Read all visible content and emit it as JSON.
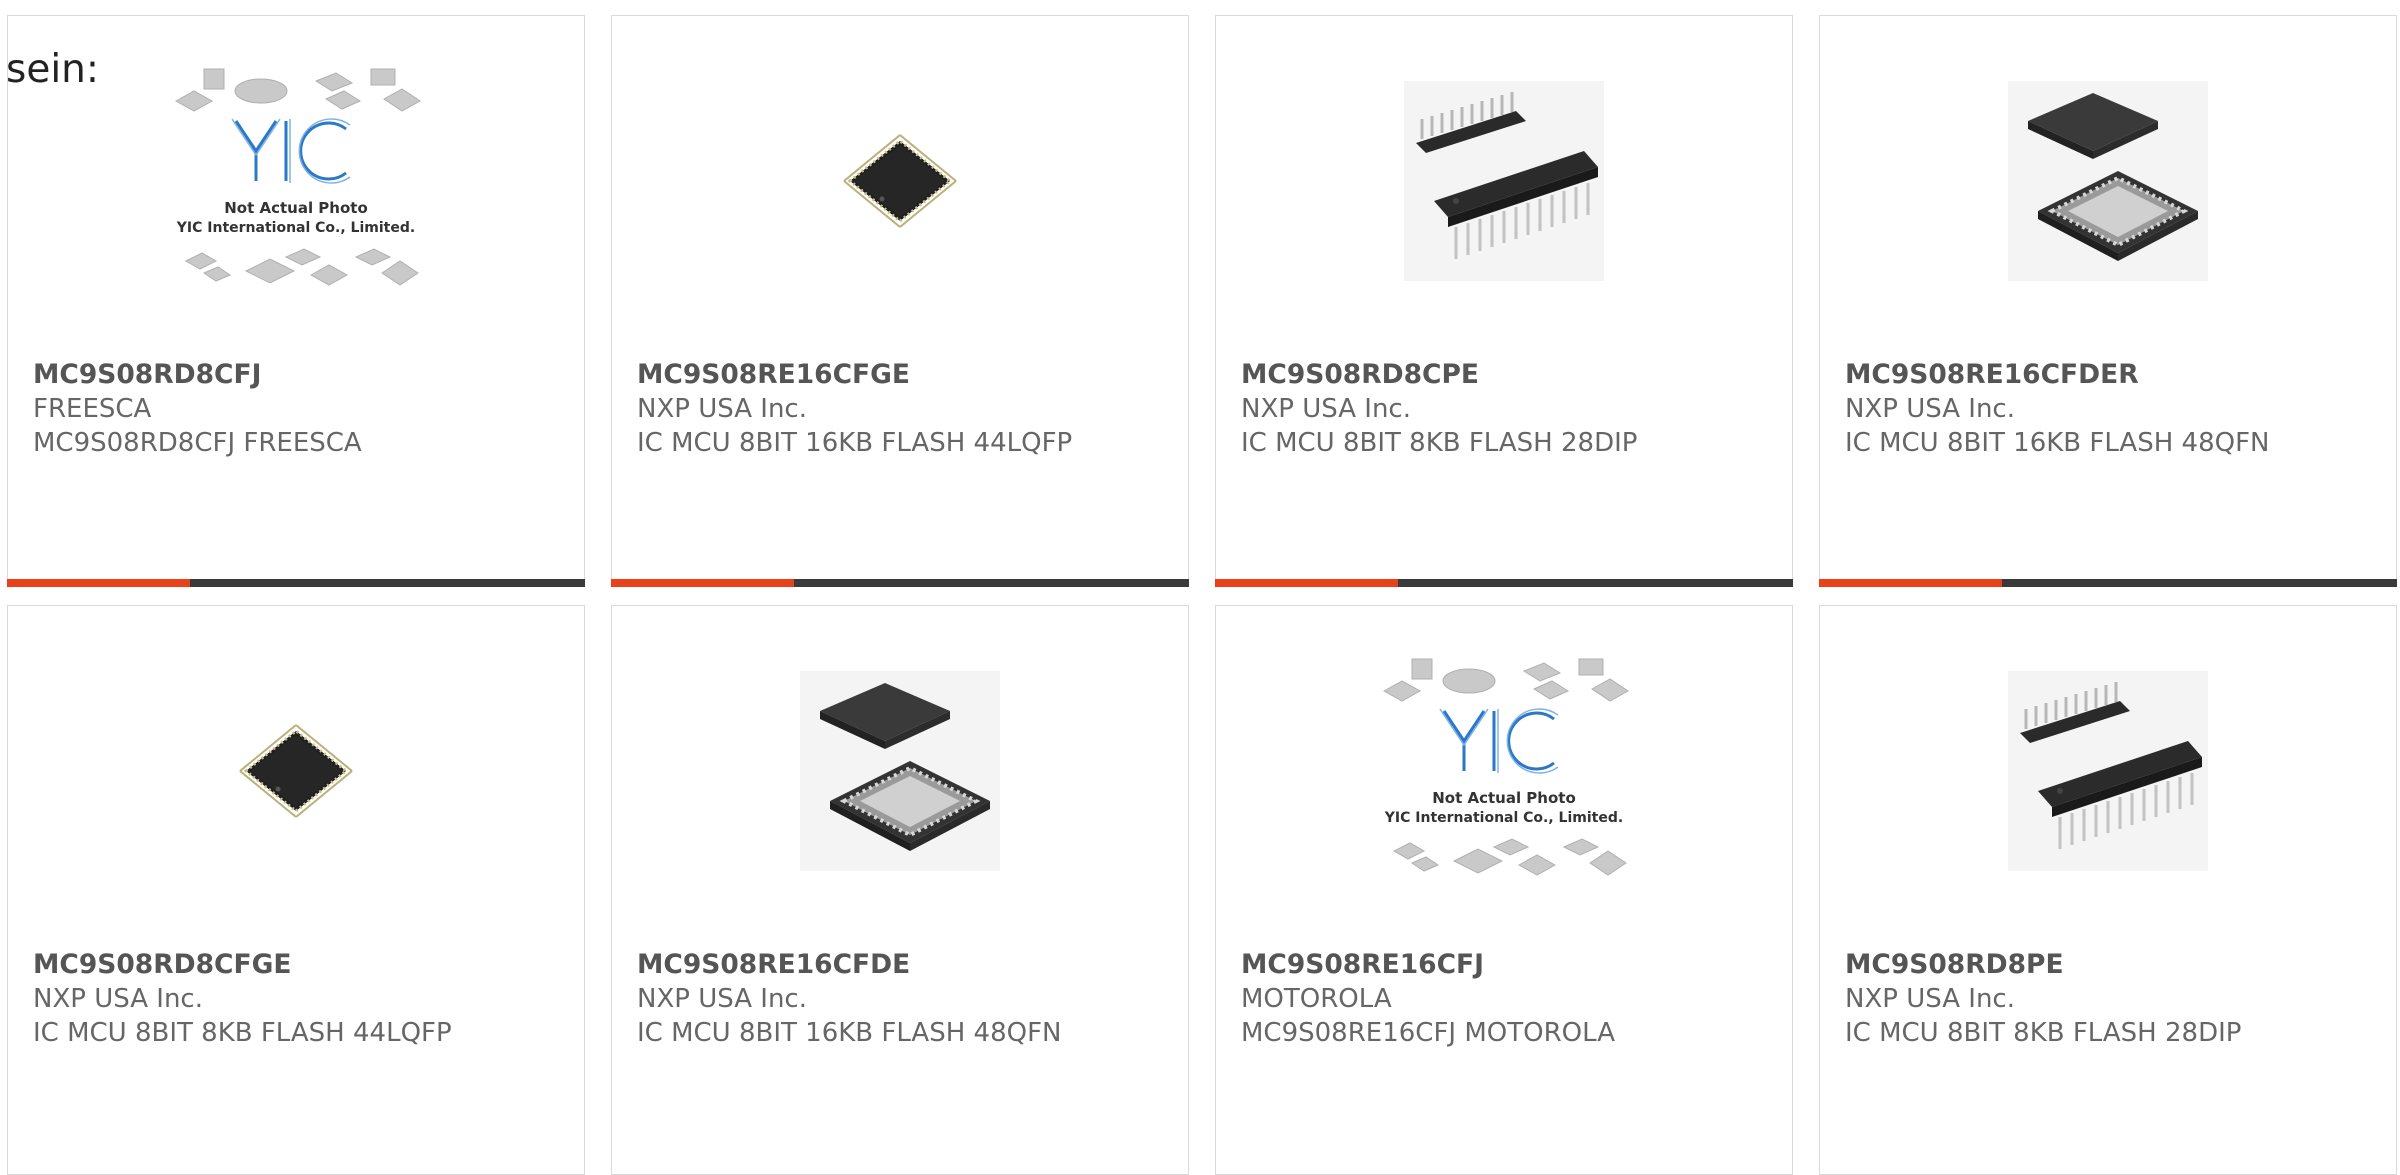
{
  "page": {
    "lead_text": "sein:"
  },
  "placeholder": {
    "line1": "Not Actual Photo",
    "line2": "YIC International Co., Limited.",
    "logo": "YIC"
  },
  "products": [
    {
      "part": "MC9S08RD8CFJ",
      "manufacturer": "FREESCA",
      "description": "MC9S08RD8CFJ FREESCA",
      "image": "placeholder-photo"
    },
    {
      "part": "MC9S08RE16CFGE",
      "manufacturer": "NXP USA Inc.",
      "description": "IC MCU 8BIT 16KB FLASH 44LQFP",
      "image": "lqfp-chip"
    },
    {
      "part": "MC9S08RD8CPE",
      "manufacturer": "NXP USA Inc.",
      "description": "IC MCU 8BIT 8KB FLASH 28DIP",
      "image": "dip-chip"
    },
    {
      "part": "MC9S08RE16CFDER",
      "manufacturer": "NXP USA Inc.",
      "description": "IC MCU 8BIT 16KB FLASH 48QFN",
      "image": "qfn-chip"
    },
    {
      "part": "MC9S08RD8CFGE",
      "manufacturer": "NXP USA Inc.",
      "description": "IC MCU 8BIT 8KB FLASH 44LQFP",
      "image": "lqfp-chip"
    },
    {
      "part": "MC9S08RE16CFDE",
      "manufacturer": "NXP USA Inc.",
      "description": "IC MCU 8BIT 16KB FLASH 48QFN",
      "image": "qfn-chip"
    },
    {
      "part": "MC9S08RE16CFJ",
      "manufacturer": "MOTOROLA",
      "description": "MC9S08RE16CFJ MOTOROLA",
      "image": "placeholder-photo"
    },
    {
      "part": "MC9S08RD8PE",
      "manufacturer": "NXP USA Inc.",
      "description": "IC MCU 8BIT 8KB FLASH 28DIP",
      "image": "dip-chip"
    }
  ],
  "colors": {
    "accent": "#e8411c",
    "bar": "#3a3a3a",
    "border": "#d9d9d9",
    "logo_blue": "#2a78c7"
  }
}
